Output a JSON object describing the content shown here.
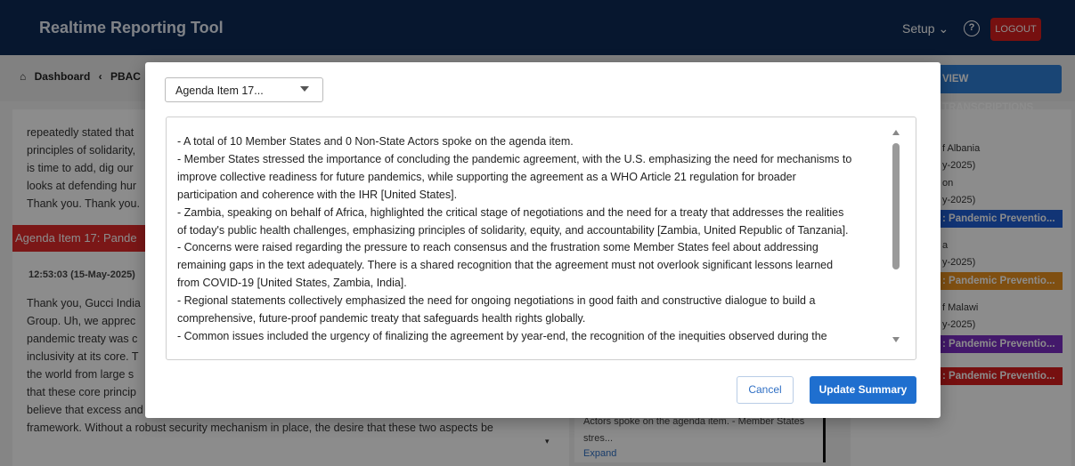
{
  "header": {
    "app_title": "Realtime Reporting Tool",
    "setup_label": "Setup ⌄",
    "help_icon": "?",
    "logout_label": "LOGOUT"
  },
  "breadcrumb": {
    "home_icon": "⌂",
    "dashboard": "Dashboard",
    "chevron": "‹",
    "current": "PBAC"
  },
  "view_transcriptions_label": "VIEW TRANSCRIPTIONS",
  "left_panel": {
    "lines_top": [
      "repeatedly stated that",
      "principles of solidarity,",
      "is time to add, dig our",
      "looks at defending hur",
      "Thank you. Thank you."
    ],
    "agenda_bar": "Agenda Item 17: Pande",
    "timestamp": "12:53:03 (15-May-2025)",
    "lines_bottom": [
      "Thank you, Gucci India",
      "Group. Uh, we apprec",
      "pandemic treaty was c",
      "inclusivity at its core. T",
      "the world from large s",
      "that these core princip",
      "believe that excess and",
      "framework. Without a robust security mechanism in place, the desire that these two aspects be"
    ],
    "scroll_caret": "▾"
  },
  "middle_card": {
    "line1": "Actors spoke on the agenda item. - Member States",
    "line2": "stres...",
    "expand": "Expand"
  },
  "right_panel": {
    "texts": [
      "f Albania",
      "y-2025)",
      "on",
      "y-2025)",
      "a",
      "y-2025)",
      "f Malawi",
      "y-2025)"
    ],
    "tags": [
      {
        "label": ": Pandemic Preventio...",
        "color": "#1f5fd6"
      },
      {
        "label": ": Pandemic Preventio...",
        "color": "#e8901f"
      },
      {
        "label": ": Pandemic Preventio...",
        "color": "#7a2fc4"
      },
      {
        "label": ": Pandemic Preventio...",
        "color": "#d81e1e"
      }
    ]
  },
  "modal": {
    "select_value": "Agenda Item 17...",
    "summary_lines": [
      "- A total of 10 Member States and 0 Non-State Actors spoke on the agenda item.",
      "- Member States stressed the importance of concluding the pandemic agreement, with the U.S. emphasizing the need for mechanisms to",
      "improve collective readiness for future pandemics, while supporting the agreement as a WHO Article 21 regulation for broader",
      "participation and coherence with the IHR [United States].",
      "- Zambia, speaking on behalf of Africa, highlighted the critical stage of negotiations and the need for a treaty that addresses the realities",
      "of today's public health challenges, emphasizing principles of solidarity, equity, and accountability [Zambia, United Republic of Tanzania].",
      "- Concerns were raised regarding the pressure to reach consensus and the frustration some Member States feel about addressing",
      "remaining gaps in the text adequately. There is a shared recognition that the agreement must not overlook significant lessons learned",
      "from COVID-19 [United States, Zambia, India].",
      "- Regional statements collectively emphasized the need for ongoing negotiations in good faith and constructive dialogue to build a",
      "comprehensive, future-proof pandemic treaty that safeguards health rights globally.",
      "- Common issues included the urgency of finalizing the agreement by year-end, the recognition of the inequities observed during the"
    ],
    "cancel_label": "Cancel",
    "update_label": "Update Summary"
  }
}
